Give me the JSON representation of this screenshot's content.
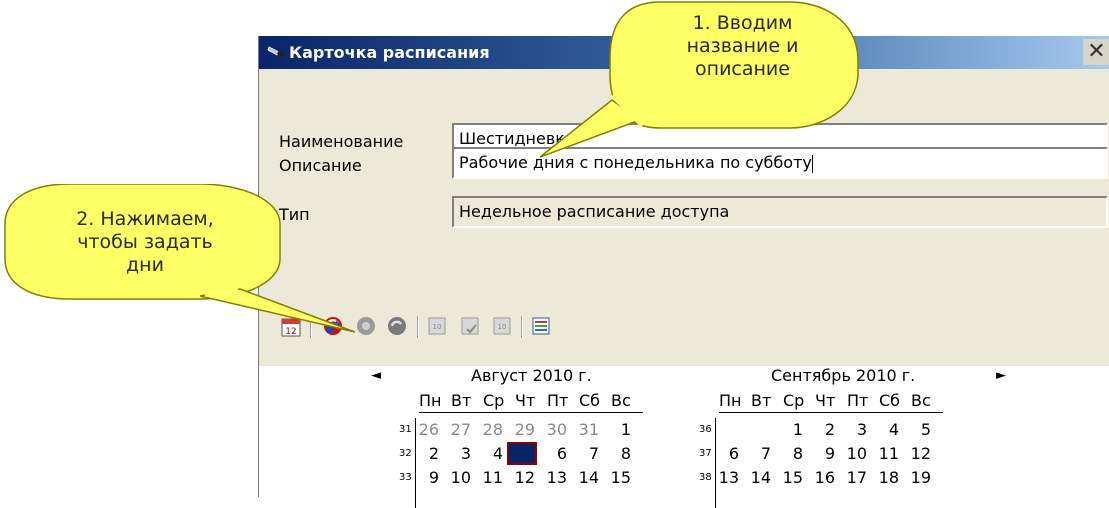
{
  "window": {
    "title": "Карточка расписания",
    "close_glyph": "✕"
  },
  "form": {
    "name_label": "Наименование",
    "name_value": "Шестидневка",
    "desc_label": "Описание",
    "desc_value": "Рабочие дния с понедельника по субботу",
    "type_label": "Тип",
    "type_value": "Недельное расписание доступа"
  },
  "toolbar": {
    "icons": [
      "calendar-icon",
      "refresh-red-icon",
      "refresh-grey-icon",
      "refresh-dark-icon",
      "day-grey-1-icon",
      "day-check-icon",
      "day-grey-2-icon",
      "grid-color-icon"
    ]
  },
  "calendar": {
    "prev_glyph": "◄",
    "next_glyph": "►",
    "months": [
      {
        "title": "Август 2010 г.",
        "weekdays": [
          "Пн",
          "Вт",
          "Ср",
          "Чт",
          "Пт",
          "Сб",
          "Вс"
        ],
        "weeks": [
          {
            "num": "31",
            "days": [
              "26",
              "27",
              "28",
              "29",
              "30",
              "31",
              "1"
            ]
          },
          {
            "num": "32",
            "days": [
              "2",
              "3",
              "4",
              "5",
              "6",
              "7",
              "8"
            ]
          },
          {
            "num": "33",
            "days": [
              "9",
              "10",
              "11",
              "12",
              "13",
              "14",
              "15"
            ]
          }
        ]
      },
      {
        "title": "Сентябрь 2010 г.",
        "weekdays": [
          "Пн",
          "Вт",
          "Ср",
          "Чт",
          "Пт",
          "Сб",
          "Вс"
        ],
        "weeks": [
          {
            "num": "36",
            "days": [
              "",
              "",
              "1",
              "2",
              "3",
              "4",
              "5"
            ]
          },
          {
            "num": "37",
            "days": [
              "6",
              "7",
              "8",
              "9",
              "10",
              "11",
              "12"
            ]
          },
          {
            "num": "38",
            "days": [
              "13",
              "14",
              "15",
              "16",
              "17",
              "18",
              "19"
            ]
          }
        ]
      }
    ]
  },
  "callouts": {
    "first": "1. Вводим\nназвание и\nописание",
    "second": "2. Нажимаем,\nчтобы задать\nдни"
  },
  "colors": {
    "callout_fill": "#ffff66",
    "callout_border": "#808000",
    "titlebar": "#0a246a",
    "selected_day": "#0a246a"
  }
}
